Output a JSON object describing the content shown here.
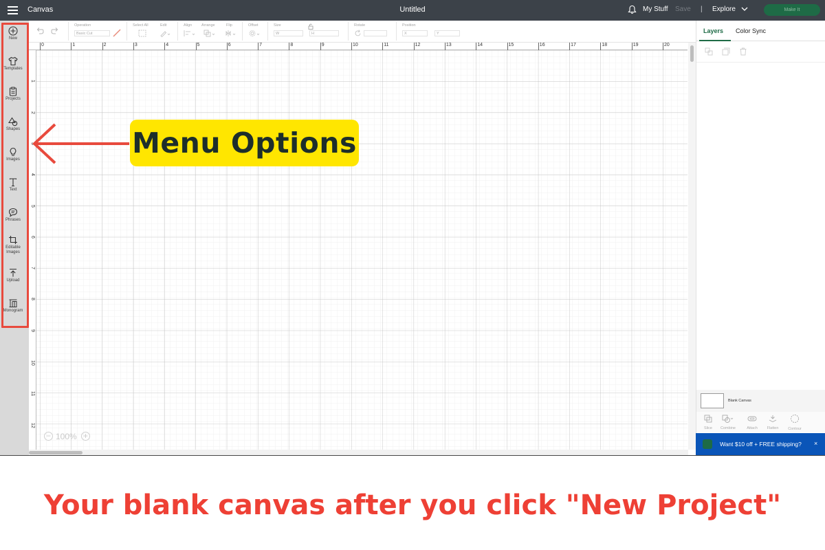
{
  "topbar": {
    "app_title": "Canvas",
    "doc_title": "Untitled",
    "my_stuff": "My Stuff",
    "save": "Save",
    "separator": "|",
    "explore": "Explore",
    "make_it": "Make It"
  },
  "toolbar": {
    "operation": "Operation",
    "operation_value": "Basic Cut",
    "select_all": "Select All",
    "edit": "Edit",
    "align": "Align",
    "arrange": "Arrange",
    "flip": "Flip",
    "offset": "Offset",
    "size": "Size",
    "size_w": "W",
    "size_h": "H",
    "rotate": "Rotate",
    "position": "Position",
    "pos_x": "X",
    "pos_y": "Y"
  },
  "sidebar": {
    "items": [
      {
        "label": "New",
        "icon": "plus-circle-icon"
      },
      {
        "label": "Templates",
        "icon": "shirt-icon"
      },
      {
        "label": "Projects",
        "icon": "clipboard-icon"
      },
      {
        "label": "Shapes",
        "icon": "shapes-icon"
      },
      {
        "label": "Images",
        "icon": "lightbulb-icon"
      },
      {
        "label": "Text",
        "icon": "text-icon"
      },
      {
        "label": "Phrases",
        "icon": "speech-bubble-icon"
      },
      {
        "label": "Editable Images",
        "icon": "crop-icon"
      },
      {
        "label": "Upload",
        "icon": "upload-icon"
      },
      {
        "label": "Monogram",
        "icon": "monogram-icon"
      }
    ]
  },
  "ruler": {
    "h_labels": [
      "0",
      "1",
      "2",
      "3",
      "4",
      "5",
      "6",
      "7",
      "8",
      "9",
      "10",
      "11",
      "12",
      "13",
      "14",
      "15",
      "16",
      "17",
      "18",
      "19",
      "20"
    ],
    "v_labels": [
      "1",
      "2",
      "3",
      "4",
      "5",
      "6",
      "7",
      "8",
      "9",
      "10",
      "11",
      "12"
    ]
  },
  "zoom": {
    "minus": "−",
    "value": "100%",
    "plus": "+"
  },
  "right_panel": {
    "tabs": [
      "Layers",
      "Color Sync"
    ],
    "layer_name": "Blank Canvas",
    "actions": [
      "Slice",
      "Combine",
      "Attach",
      "Flatten",
      "Contour"
    ]
  },
  "promo": {
    "text": "Want $10 off + FREE shipping?",
    "close": "×"
  },
  "annotation": {
    "callout": "Menu Options",
    "caption": "Your blank canvas after you click \"New Project\""
  },
  "colors": {
    "topbar": "#3c4249",
    "accent_green": "#1e6b46",
    "callout_yellow": "#ffe600",
    "annotation_red": "#ee4035",
    "promo_blue": "#0a55b8"
  }
}
